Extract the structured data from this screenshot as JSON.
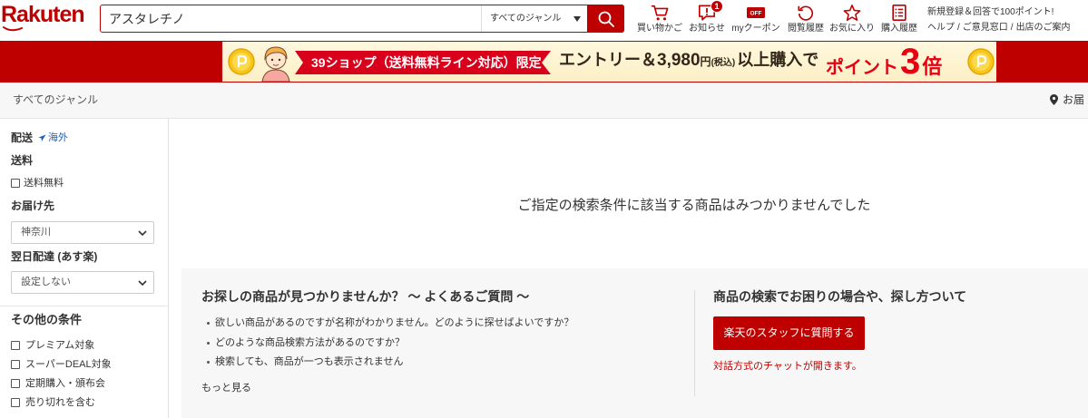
{
  "colors": {
    "brand_red": "#bf0000",
    "link_blue": "#1f5fb3",
    "banner_cream": "#fcf2cf",
    "point_red": "#e60012"
  },
  "header": {
    "logo_text": "Rakuten",
    "search": {
      "value": "アスタレチノ",
      "genre": "すべてのジャンル",
      "button_icon": "search-icon"
    },
    "icons": [
      {
        "icon": "cart-icon",
        "label": "買い物かご"
      },
      {
        "icon": "notification-icon",
        "label": "お知らせ",
        "badge": "1"
      },
      {
        "icon": "coupon-icon",
        "label": "myクーポン",
        "icon_text": "OFF"
      },
      {
        "icon": "history-icon",
        "label": "閲覧履歴"
      },
      {
        "icon": "star-icon",
        "label": "お気に入り"
      },
      {
        "icon": "purchase-history-icon",
        "label": "購入履歴"
      }
    ],
    "promo": "新規登録＆回答で100ポイント!",
    "links": [
      "ヘルプ",
      "ご意見窓口",
      "出店のご案内"
    ],
    "link_separator": "/"
  },
  "banner": {
    "ribbon": "39ショップ（送料無料ライン対応）限定",
    "entry": "エントリー＆",
    "amount": "3,980",
    "yen": "円",
    "tax": "(税込)",
    "condition": "以上購入で",
    "point_label": "ポイント",
    "multiplier": "3",
    "multiplier_unit": "倍"
  },
  "breadcrumb": {
    "root": "すべてのジャンル",
    "delivery": "お届",
    "delivery_icon": "location-pin-icon"
  },
  "sidebar": {
    "delivery": {
      "label": "配送",
      "overseas": "海外",
      "overseas_icon": "plane-icon"
    },
    "shipping": {
      "label": "送料",
      "free": {
        "label": "送料無料",
        "checked": false
      }
    },
    "destination": {
      "label": "お届け先",
      "selected": "神奈川"
    },
    "next_day": {
      "label": "翌日配達 (あす楽)",
      "selected": "設定しない"
    },
    "other": {
      "label": "その他の条件",
      "options": [
        {
          "label": "プレミアム対象",
          "checked": false
        },
        {
          "label": "スーパーDEAL対象",
          "checked": false
        },
        {
          "label": "定期購入・頒布会",
          "checked": false
        },
        {
          "label": "売り切れを含む",
          "checked": false
        }
      ]
    }
  },
  "main": {
    "no_results": "ご指定の検索条件に該当する商品はみつかりませんでした",
    "faq": {
      "title": "お探しの商品が見つかりませんか？ 〜 よくあるご質問 〜",
      "items": [
        "欲しい商品があるのですが名称がわかりません。どのように探せばよいですか？",
        "どのような商品検索方法があるのですか？",
        "検索しても、商品が一つも表示されません"
      ],
      "more": "もっと見る"
    },
    "help": {
      "title": "商品の検索でお困りの場合や、探し方ついて",
      "button": "楽天のスタッフに質問する",
      "note": "対話方式のチャットが開きます。"
    }
  }
}
